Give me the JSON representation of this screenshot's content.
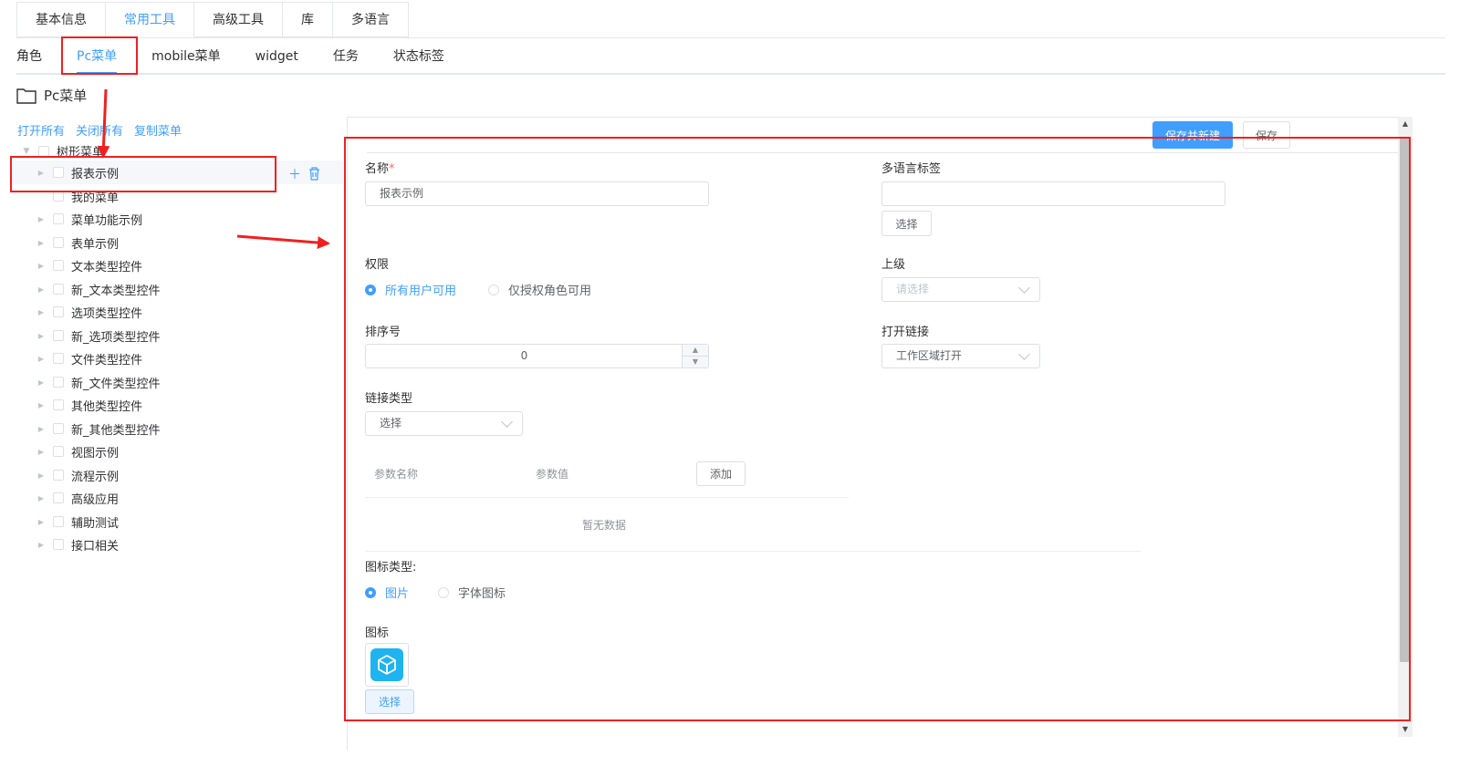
{
  "top_tabs": [
    "基本信息",
    "常用工具",
    "高级工具",
    "库",
    "多语言"
  ],
  "top_tab_active_index": 1,
  "sub_tabs": [
    "角色",
    "Pc菜单",
    "mobile菜单",
    "widget",
    "任务",
    "状态标签"
  ],
  "sub_tab_active_index": 1,
  "folder_title": "Pc菜单",
  "tree": {
    "actions": [
      "打开所有",
      "关闭所有",
      "复制菜单"
    ],
    "root": "树形菜单",
    "nodes": [
      "报表示例",
      "我的菜单",
      "菜单功能示例",
      "表单示例",
      "文本类型控件",
      "新_文本类型控件",
      "选项类型控件",
      "新_选项类型控件",
      "文件类型控件",
      "新_文件类型控件",
      "其他类型控件",
      "新_其他类型控件",
      "视图示例",
      "流程示例",
      "高级应用",
      "辅助测试",
      "接口相关"
    ],
    "selected_index": 0
  },
  "toolbar": {
    "save_and_new": "保存并新建",
    "save": "保存"
  },
  "form": {
    "name": {
      "label": "名称",
      "required_mark": "*",
      "value": "报表示例"
    },
    "i18n": {
      "label": "多语言标签",
      "value": "",
      "button": "选择"
    },
    "permission": {
      "label": "权限",
      "options": [
        "所有用户可用",
        "仅授权角色可用"
      ],
      "selected_index": 0
    },
    "parent": {
      "label": "上级",
      "placeholder": "请选择"
    },
    "sort": {
      "label": "排序号",
      "value": "0"
    },
    "open_link": {
      "label": "打开链接",
      "value": "工作区域打开"
    },
    "link_type": {
      "label": "链接类型",
      "value": "选择"
    },
    "params": {
      "col_name": "参数名称",
      "col_value": "参数值",
      "add_button": "添加",
      "empty_text": "暂无数据"
    },
    "icon_type": {
      "label": "图标类型:",
      "options": [
        "图片",
        "字体图标"
      ],
      "selected_index": 0
    },
    "icon": {
      "label": "图标",
      "button": "选择",
      "icon_name": "cube-icon"
    }
  },
  "colors": {
    "accent": "#409eff",
    "annotation_red": "#f02020",
    "icon_tile": "#1fb3f0"
  }
}
